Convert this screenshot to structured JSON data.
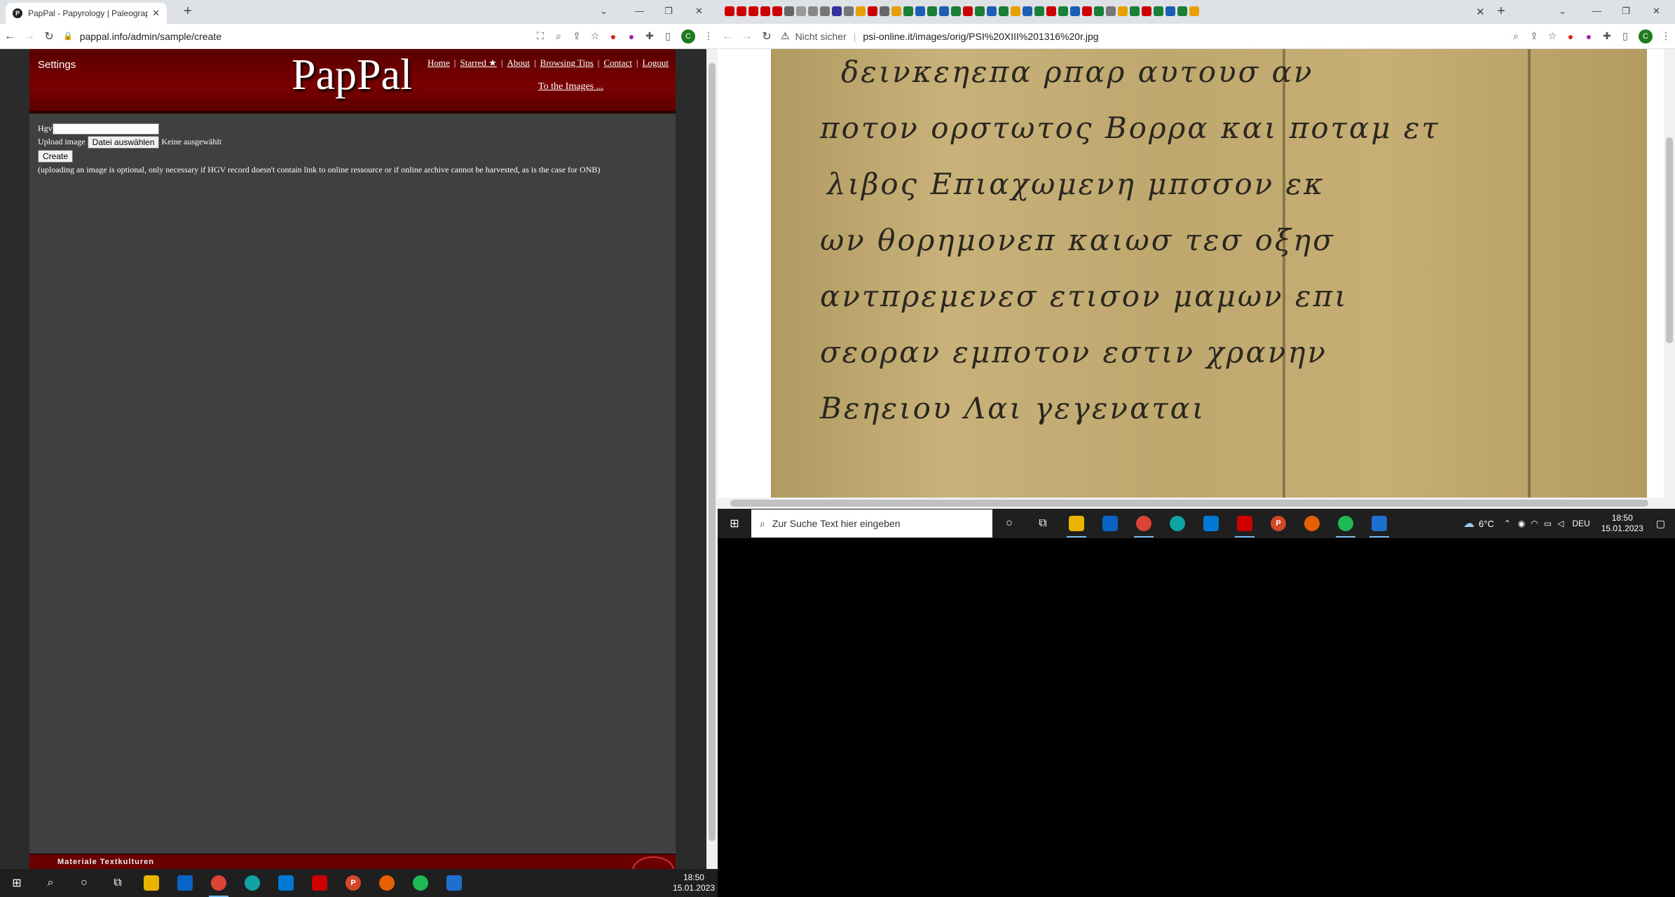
{
  "left": {
    "tab_title": "PapPal - Papyrology | Paleograph",
    "url": "pappal.info/admin/sample/create",
    "page": {
      "settings": "Settings",
      "logo": "PapPal",
      "nav": [
        "Home",
        "Starred ★",
        "About",
        "Browsing Tips",
        "Contact",
        "Logout"
      ],
      "to_images": "To the Images ...",
      "form": {
        "hgv_label": "Hgv",
        "hgv_value": "",
        "upload_label": "Upload image",
        "file_button": "Datei auswählen",
        "file_status": "Keine ausgewählt",
        "create_button": "Create",
        "note": "(uploading an image is optional, only necessary if HGV record doesn't contain link to online ressource or if online archive cannot be harvested, as is the case for ONB)"
      },
      "footer_text": "Materiale Textkulturen"
    },
    "taskbar_clock": {
      "time": "18:50",
      "date": "15.01.2023"
    }
  },
  "right": {
    "security_label": "Nicht sicher",
    "url": "psi-online.it/images/orig/PSI%20XIII%201316%20r.jpg",
    "papyrus_lines": [
      "δεινκεηεπα ρπαρ αυτουσ αν",
      "ποτον ορστωτος Βορρα και ποταμ ετ",
      "λιβος Επιαχωμενη μπσσον εκ",
      "ων θορημονεπ καιωσ τεσ οξησ",
      "αντπρεμενεσ ετισον μαμων επι",
      "σεοραν εμποτον εστιν χρανην",
      "Βεηειου  Λαι γεγεναται"
    ],
    "taskbar": {
      "search_placeholder": "Zur Suche Text hier eingeben",
      "weather": "6°C",
      "language": "DEU",
      "time": "18:50",
      "date": "15.01.2023"
    }
  },
  "colors": {
    "header_red": "#7a0000",
    "page_gray": "#404040",
    "taskbar": "#1f1f1f",
    "papyrus": "#c8b27a"
  }
}
